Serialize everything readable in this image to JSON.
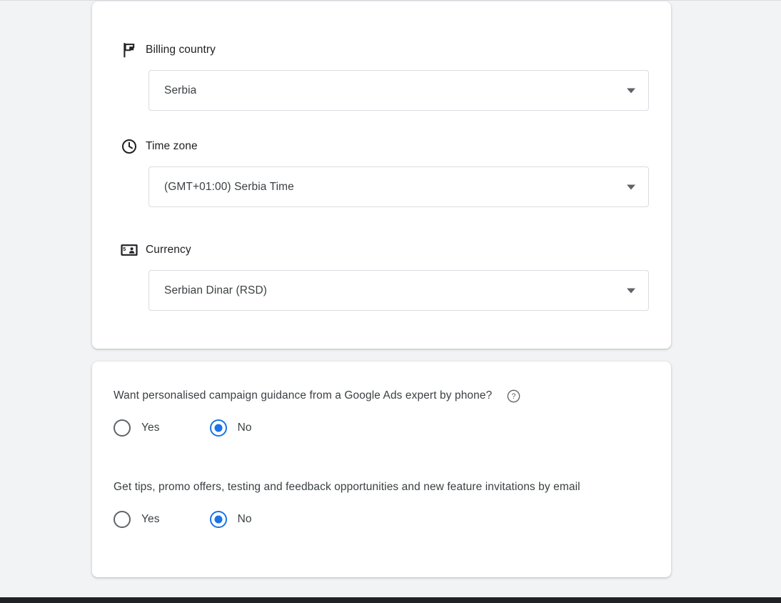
{
  "colors": {
    "page_background": "#f1f3f4",
    "card_background": "#ffffff",
    "accent": "#1a73e8",
    "label_text": "#202124",
    "body_text": "#3c4043",
    "border": "#dadce0",
    "icon": "#202124",
    "muted_icon": "#5f6368",
    "bottom_bar": "#202124"
  },
  "locale_card": {
    "fields": [
      {
        "label": "Billing country",
        "icon": "flag-icon",
        "value": "Serbia",
        "dropdown_icon": "chevron-down-icon"
      },
      {
        "label": "Time zone",
        "icon": "clock-icon",
        "value": "(GMT+01:00) Serbia Time",
        "dropdown_icon": "chevron-down-icon"
      },
      {
        "label": "Currency",
        "icon": "banknote-icon",
        "value": "Serbian Dinar (RSD)",
        "dropdown_icon": "chevron-down-icon"
      }
    ]
  },
  "preferences_card": {
    "questions": [
      {
        "text": "Want personalised campaign guidance from a Google Ads expert by phone?",
        "help_icon": "help-circle-icon",
        "has_help": true,
        "options": [
          {
            "label": "Yes",
            "selected": false
          },
          {
            "label": "No",
            "selected": true
          }
        ]
      },
      {
        "text": "Get tips, promo offers, testing and feedback opportunities and new feature invitations by email",
        "has_help": false,
        "options": [
          {
            "label": "Yes",
            "selected": false
          },
          {
            "label": "No",
            "selected": true
          }
        ]
      }
    ]
  }
}
